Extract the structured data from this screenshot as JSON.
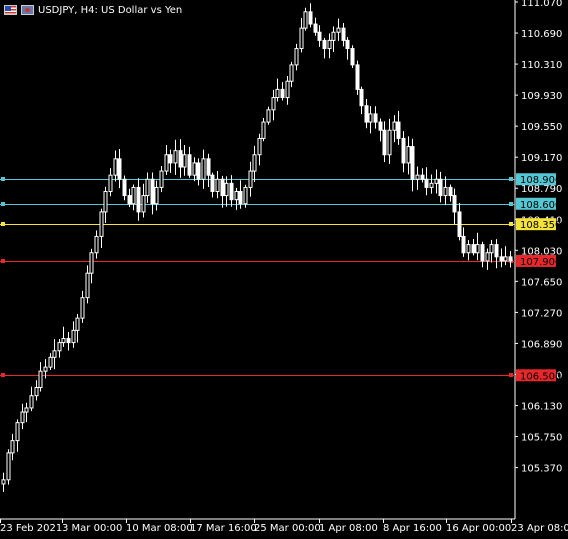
{
  "header": {
    "symbol": "USDJPY",
    "timeframe": "H4",
    "description": "US Dollar vs Yen",
    "title_text": "USDJPY, H4:  US Dollar vs Yen"
  },
  "colors": {
    "background": "#000000",
    "candle": "#ffffff",
    "axis": "#ffffff"
  },
  "chart_data": {
    "type": "candlestick",
    "symbol": "USDJPY",
    "timeframe": "H4",
    "title": "USDJPY, H4:  US Dollar vs Yen",
    "ylim": [
      105.12,
      111.07
    ],
    "y_ticks": [
      "111.070",
      "110.690",
      "110.310",
      "109.930",
      "109.550",
      "109.170",
      "108.790",
      "108.410",
      "108.030",
      "107.650",
      "107.270",
      "106.890",
      "106.510",
      "106.130",
      "105.750",
      "105.370"
    ],
    "x_ticks": [
      "23 Feb 2021",
      "3 Mar 00:00",
      "10 Mar 08:00",
      "17 Mar 16:00",
      "25 Mar 00:00",
      "1 Apr 08:00",
      "8 Apr 16:00",
      "16 Apr 00:00",
      "23 Apr 08:00"
    ],
    "series": [
      {
        "name": "close",
        "values": [
          105.22,
          105.55,
          105.7,
          105.92,
          106.05,
          106.1,
          106.25,
          106.35,
          106.55,
          106.6,
          106.72,
          106.8,
          106.9,
          106.95,
          106.9,
          107.05,
          107.2,
          107.45,
          107.75,
          108.0,
          108.2,
          108.5,
          108.75,
          108.95,
          109.15,
          108.9,
          108.7,
          108.6,
          108.8,
          108.5,
          108.7,
          108.9,
          108.6,
          108.8,
          109.0,
          109.2,
          109.1,
          109.25,
          109.05,
          109.2,
          108.95,
          109.1,
          108.9,
          109.15,
          108.95,
          108.75,
          108.9,
          108.7,
          108.85,
          108.65,
          108.75,
          108.6,
          108.8,
          109.0,
          109.2,
          109.4,
          109.6,
          109.75,
          109.9,
          110.0,
          109.9,
          110.1,
          110.3,
          110.5,
          110.75,
          110.95,
          110.8,
          110.7,
          110.6,
          110.5,
          110.6,
          110.7,
          110.75,
          110.6,
          110.5,
          110.3,
          110.0,
          109.8,
          109.6,
          109.7,
          109.6,
          109.5,
          109.2,
          109.5,
          109.6,
          109.4,
          109.1,
          109.3,
          108.9,
          108.95,
          108.9,
          108.8,
          108.85,
          108.9,
          108.7,
          108.8,
          108.7,
          108.5,
          108.2,
          108.0,
          108.1,
          108.0,
          108.1,
          107.9,
          108.0,
          108.1,
          107.95,
          107.9,
          107.95,
          107.9
        ]
      }
    ],
    "horizontal_levels": [
      {
        "value": 108.9,
        "label": "108.900",
        "color": "#54c7d4"
      },
      {
        "value": 108.6,
        "label": "108.600",
        "color": "#54c7d4"
      },
      {
        "value": 108.35,
        "label": "108.350",
        "color": "#f5e33a"
      },
      {
        "value": 107.9,
        "label": "107.900",
        "color": "#e8272b"
      },
      {
        "value": 106.5,
        "label": "106.500",
        "color": "#e8272b"
      }
    ],
    "grid": false
  }
}
